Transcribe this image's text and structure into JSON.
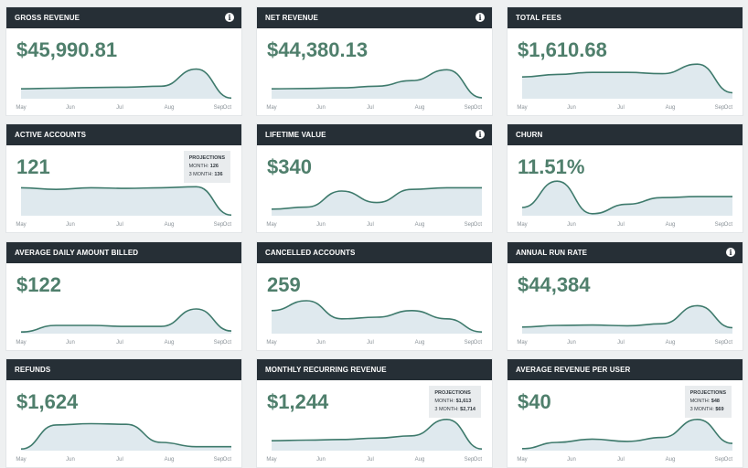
{
  "months": [
    "May",
    "Jun",
    "Jul",
    "Aug",
    "Sep",
    "Oct"
  ],
  "colors": {
    "header": "#262f36",
    "metric": "#4f7f6c",
    "line": "#3e7a6c",
    "fill": "#dfe9ee"
  },
  "cards": [
    {
      "title": "GROSS REVENUE",
      "value": "$45,990.81",
      "info": true,
      "trend": [
        0.3,
        0.32,
        0.34,
        0.35,
        0.38,
        0.9,
        0.02
      ],
      "projection": null
    },
    {
      "title": "NET REVENUE",
      "value": "$44,380.13",
      "info": true,
      "trend": [
        0.3,
        0.31,
        0.33,
        0.38,
        0.55,
        0.88,
        0.03
      ],
      "projection": null
    },
    {
      "title": "TOTAL FEES",
      "value": "$1,610.68",
      "info": false,
      "trend": [
        0.66,
        0.74,
        0.8,
        0.8,
        0.76,
        1.05,
        0.18
      ],
      "projection": null
    },
    {
      "title": "ACTIVE ACCOUNTS",
      "value": "121",
      "info": false,
      "trend": [
        0.85,
        0.8,
        0.85,
        0.83,
        0.85,
        0.88,
        0.02
      ],
      "projection": {
        "title": "PROJECTIONS",
        "month_label": "MONTH:",
        "month_value": "126",
        "three_label": "3 MONTH:",
        "three_value": "136"
      }
    },
    {
      "title": "LIFETIME VALUE",
      "value": "$340",
      "info": true,
      "trend": [
        0.2,
        0.26,
        0.75,
        0.4,
        0.8,
        0.85,
        0.85
      ],
      "projection": null
    },
    {
      "title": "CHURN",
      "value": "11.51%",
      "info": false,
      "trend": [
        0.25,
        1.05,
        0.06,
        0.35,
        0.55,
        0.58,
        0.58
      ],
      "projection": null
    },
    {
      "title": "AVERAGE DAILY AMOUNT BILLED",
      "value": "$122",
      "info": false,
      "trend": [
        0.05,
        0.25,
        0.25,
        0.22,
        0.22,
        0.75,
        0.08
      ],
      "projection": null
    },
    {
      "title": "CANCELLED ACCOUNTS",
      "value": "259",
      "info": false,
      "trend": [
        0.7,
        1.0,
        0.45,
        0.5,
        0.7,
        0.45,
        0.05
      ],
      "projection": null
    },
    {
      "title": "ANNUAL RUN RATE",
      "value": "$44,384",
      "info": true,
      "trend": [
        0.2,
        0.25,
        0.26,
        0.24,
        0.3,
        0.85,
        0.18
      ],
      "projection": null
    },
    {
      "title": "REFUNDS",
      "value": "$1,624",
      "info": false,
      "trend": [
        0.05,
        0.78,
        0.82,
        0.8,
        0.25,
        0.12,
        0.12
      ],
      "projection": null
    },
    {
      "title": "MONTHLY RECURRING REVENUE",
      "value": "$1,244",
      "info": false,
      "trend": [
        0.3,
        0.32,
        0.34,
        0.38,
        0.45,
        0.95,
        0.05
      ],
      "projection": {
        "title": "PROJECTIONS",
        "month_label": "MONTH:",
        "month_value": "$1,613",
        "three_label": "3 MONTH:",
        "three_value": "$2,714"
      }
    },
    {
      "title": "AVERAGE REVENUE PER USER",
      "value": "$40",
      "info": false,
      "trend": [
        0.06,
        0.25,
        0.35,
        0.28,
        0.4,
        0.95,
        0.22
      ],
      "projection": {
        "title": "PROJECTIONS",
        "month_label": "MONTH:",
        "month_value": "$48",
        "three_label": "3 MONTH:",
        "three_value": "$69"
      }
    }
  ]
}
